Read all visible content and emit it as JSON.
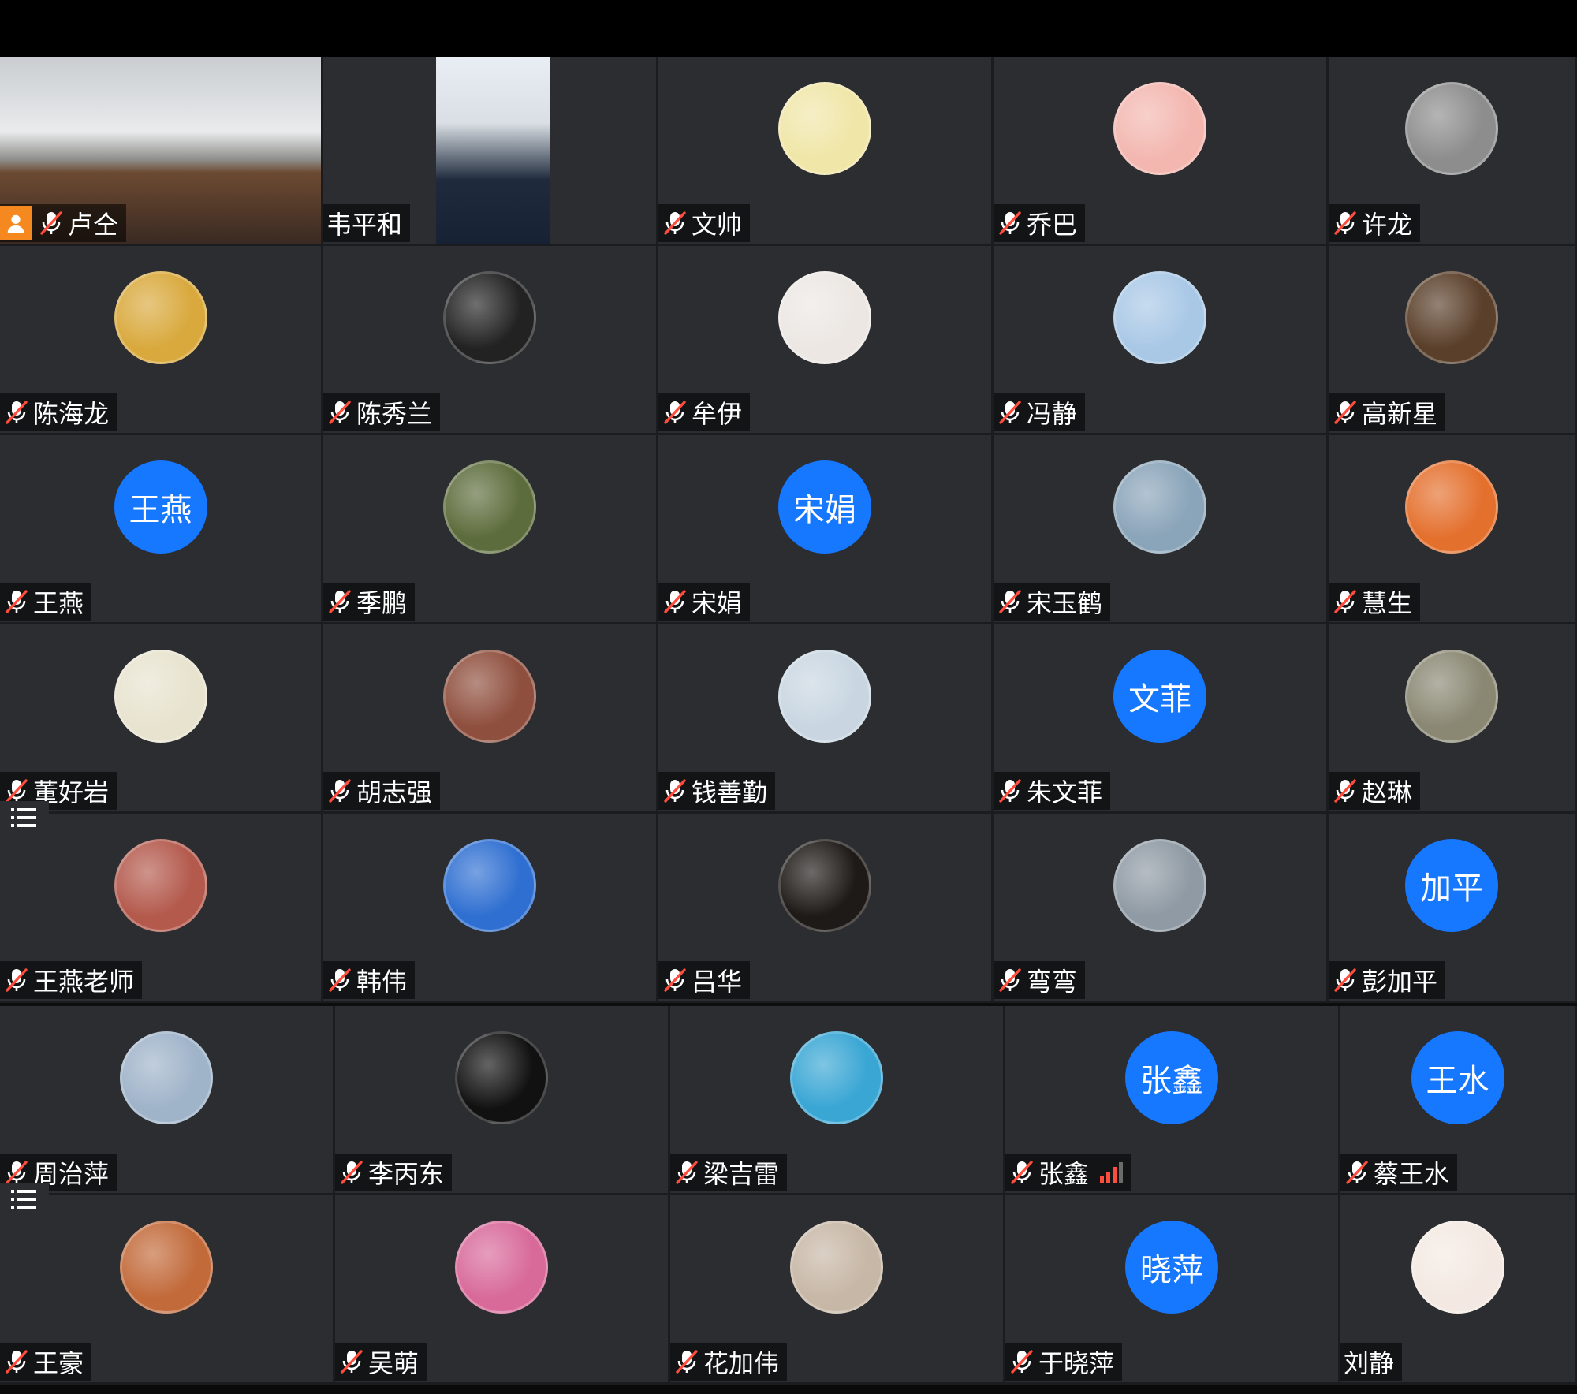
{
  "participants_top": [
    {
      "name": "卢仝",
      "type": "video",
      "muted": true,
      "host": true
    },
    {
      "name": "韦平和",
      "type": "video",
      "muted": false
    },
    {
      "name": "文帅",
      "type": "photo",
      "muted": true,
      "bg": "#f0e6a8"
    },
    {
      "name": "乔巴",
      "type": "photo",
      "muted": true,
      "bg": "#f3b7b0"
    },
    {
      "name": "许龙",
      "type": "photo",
      "muted": true,
      "bg": "#8d8d8d"
    },
    {
      "name": "陈海龙",
      "type": "photo",
      "muted": true,
      "bg": "#d9a93d"
    },
    {
      "name": "陈秀兰",
      "type": "photo",
      "muted": true,
      "bg": "#222"
    },
    {
      "name": "牟伊",
      "type": "photo",
      "muted": true,
      "bg": "#ece7e3"
    },
    {
      "name": "冯静",
      "type": "photo",
      "muted": true,
      "bg": "#a9c8e6"
    },
    {
      "name": "高新星",
      "type": "photo",
      "muted": true,
      "bg": "#5a3f2a"
    },
    {
      "name": "王燕",
      "type": "text",
      "muted": true,
      "initials": "王燕"
    },
    {
      "name": "季鹏",
      "type": "photo",
      "muted": true,
      "bg": "#5d6c3c"
    },
    {
      "name": "宋娟",
      "type": "text",
      "muted": true,
      "initials": "宋娟"
    },
    {
      "name": "宋玉鹤",
      "type": "photo",
      "muted": true,
      "bg": "#8aa4b9"
    },
    {
      "name": "慧生",
      "type": "photo",
      "muted": true,
      "bg": "#e4702e"
    },
    {
      "name": "董好岩",
      "type": "photo",
      "muted": true,
      "bg": "#e8e3cf"
    },
    {
      "name": "胡志强",
      "type": "photo",
      "muted": true,
      "bg": "#8f4f3e"
    },
    {
      "name": "钱善勤",
      "type": "photo",
      "muted": true,
      "bg": "#c9d6e1"
    },
    {
      "name": "朱文菲",
      "type": "text",
      "muted": true,
      "initials": "文菲"
    },
    {
      "name": "赵琳",
      "type": "photo",
      "muted": true,
      "bg": "#8a8873"
    },
    {
      "name": "王燕老师",
      "type": "photo",
      "muted": true,
      "bg": "#b45a4d"
    },
    {
      "name": "韩伟",
      "type": "photo",
      "muted": true,
      "bg": "#2f6fd1"
    },
    {
      "name": "吕华",
      "type": "photo",
      "muted": true,
      "bg": "#1e1a17"
    },
    {
      "name": "弯弯",
      "type": "photo",
      "muted": true,
      "bg": "#8f9aa4"
    },
    {
      "name": "彭加平",
      "type": "text",
      "muted": true,
      "initials": "加平"
    }
  ],
  "participants_bottom": [
    {
      "name": "周治萍",
      "type": "photo",
      "muted": true,
      "bg": "#9fb3c9"
    },
    {
      "name": "李丙东",
      "type": "photo",
      "muted": true,
      "bg": "#111"
    },
    {
      "name": "梁吉雷",
      "type": "photo",
      "muted": true,
      "bg": "#39a6d4"
    },
    {
      "name": "张鑫",
      "type": "text",
      "muted": true,
      "initials": "张鑫",
      "signal": true
    },
    {
      "name": "蔡王水",
      "type": "text",
      "muted": true,
      "initials": "王水"
    },
    {
      "name": "王豪",
      "type": "photo",
      "muted": true,
      "bg": "#c26a3a"
    },
    {
      "name": "吴萌",
      "type": "photo",
      "muted": true,
      "bg": "#d86a9a"
    },
    {
      "name": "花加伟",
      "type": "photo",
      "muted": true,
      "bg": "#c7b7a6"
    },
    {
      "name": "于晓萍",
      "type": "text",
      "muted": true,
      "initials": "晓萍"
    },
    {
      "name": "刘静",
      "type": "photo",
      "muted": false,
      "bg": "#f3e9e2"
    }
  ],
  "colors": {
    "tile_bg": "#2b2d31",
    "text_avatar": "#1677ff",
    "mute_red": "#ff4d3d",
    "host_orange": "#f5891f"
  }
}
